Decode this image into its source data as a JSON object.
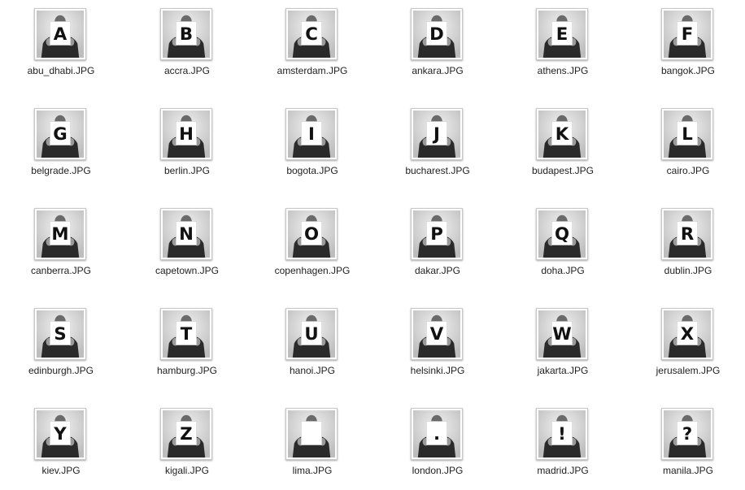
{
  "files": [
    {
      "name": "abu_dhabi.JPG",
      "letter": "A"
    },
    {
      "name": "accra.JPG",
      "letter": "B"
    },
    {
      "name": "amsterdam.JPG",
      "letter": "C"
    },
    {
      "name": "ankara.JPG",
      "letter": "D"
    },
    {
      "name": "athens.JPG",
      "letter": "E"
    },
    {
      "name": "bangok.JPG",
      "letter": "F"
    },
    {
      "name": "belgrade.JPG",
      "letter": "G"
    },
    {
      "name": "berlin.JPG",
      "letter": "H"
    },
    {
      "name": "bogota.JPG",
      "letter": "I"
    },
    {
      "name": "bucharest.JPG",
      "letter": "J"
    },
    {
      "name": "budapest.JPG",
      "letter": "K"
    },
    {
      "name": "cairo.JPG",
      "letter": "L"
    },
    {
      "name": "canberra.JPG",
      "letter": "M"
    },
    {
      "name": "capetown.JPG",
      "letter": "N"
    },
    {
      "name": "copenhagen.JPG",
      "letter": "O"
    },
    {
      "name": "dakar.JPG",
      "letter": "P"
    },
    {
      "name": "doha.JPG",
      "letter": "Q"
    },
    {
      "name": "dublin.JPG",
      "letter": "R"
    },
    {
      "name": "edinburgh.JPG",
      "letter": "S"
    },
    {
      "name": "hamburg.JPG",
      "letter": "T"
    },
    {
      "name": "hanoi.JPG",
      "letter": "U"
    },
    {
      "name": "helsinki.JPG",
      "letter": "V"
    },
    {
      "name": "jakarta.JPG",
      "letter": "W"
    },
    {
      "name": "jerusalem.JPG",
      "letter": "X"
    },
    {
      "name": "kiev.JPG",
      "letter": "Y"
    },
    {
      "name": "kigali.JPG",
      "letter": "Z"
    },
    {
      "name": "lima.JPG",
      "letter": ""
    },
    {
      "name": "london.JPG",
      "letter": "."
    },
    {
      "name": "madrid.JPG",
      "letter": "!"
    },
    {
      "name": "manila.JPG",
      "letter": "?"
    }
  ],
  "colors": {
    "background": "#ffffff",
    "label": "#222222",
    "photo_backdrop": "#d9d9d9",
    "jacket": "#2a2a2a",
    "card": "#ffffff"
  },
  "icon": "photo-thumbnail-icon"
}
